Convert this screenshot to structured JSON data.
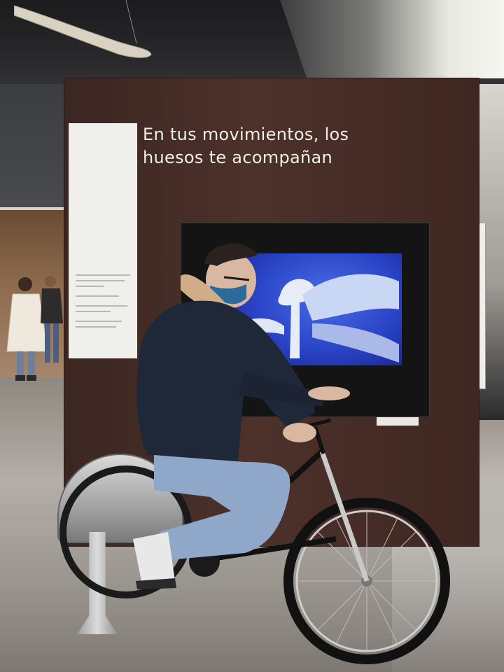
{
  "exhibit": {
    "headline_line1": "En tus movimientos, los",
    "headline_line2": "huesos te acompañan"
  },
  "colors": {
    "board": "#4a2f29",
    "screen_blue": "#2a44c7",
    "jacket": "#1f2838",
    "jeans": "#8fa7c8",
    "mask": "#2b6b9b"
  }
}
